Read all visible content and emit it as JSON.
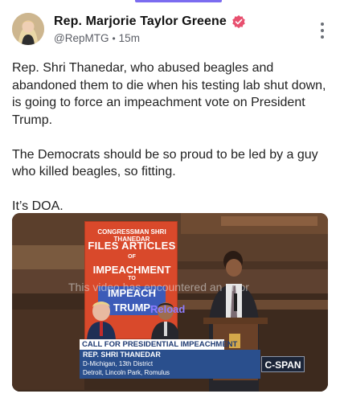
{
  "post": {
    "author_name": "Rep. Marjorie Taylor Greene",
    "handle": "@RepMTG",
    "separator": "•",
    "time_ago": "15m",
    "paragraphs": [
      "Rep. Shri Thanedar, who abused beagles and abandoned them to die when his testing lab shut down, is going to force an impeachment vote on President Trump.",
      "The Democrats should be so proud to be led by a guy who killed beagles, so fitting.",
      "It’s DOA."
    ]
  },
  "video": {
    "error_message": "This video has encountered an error",
    "reload_label": "Reload",
    "poster_lines": [
      "CONGRESSMAN SHRI THANEDAR",
      "FILES ARTICLES",
      "OF",
      "IMPEACHMENT",
      "TO",
      "IMPEACH TRUMP"
    ],
    "chyron_top": "CALL FOR PRESIDENTIAL IMPEACHMENT",
    "chyron_name": "REP. SHRI THANEDAR",
    "chyron_district": "D-Michigan, 13th District",
    "chyron_place": "Detroit, Lincoln Park, Romulus",
    "network_logo": "C-SPAN"
  },
  "colors": {
    "accent": "#7b6cf0",
    "verified_badge": "#e8506f",
    "reload_link": "#8e7dff",
    "chyron_blue": "#2a4f8d"
  },
  "icons": {
    "verified": "verified-badge-icon",
    "more": "more-vertical-icon"
  }
}
